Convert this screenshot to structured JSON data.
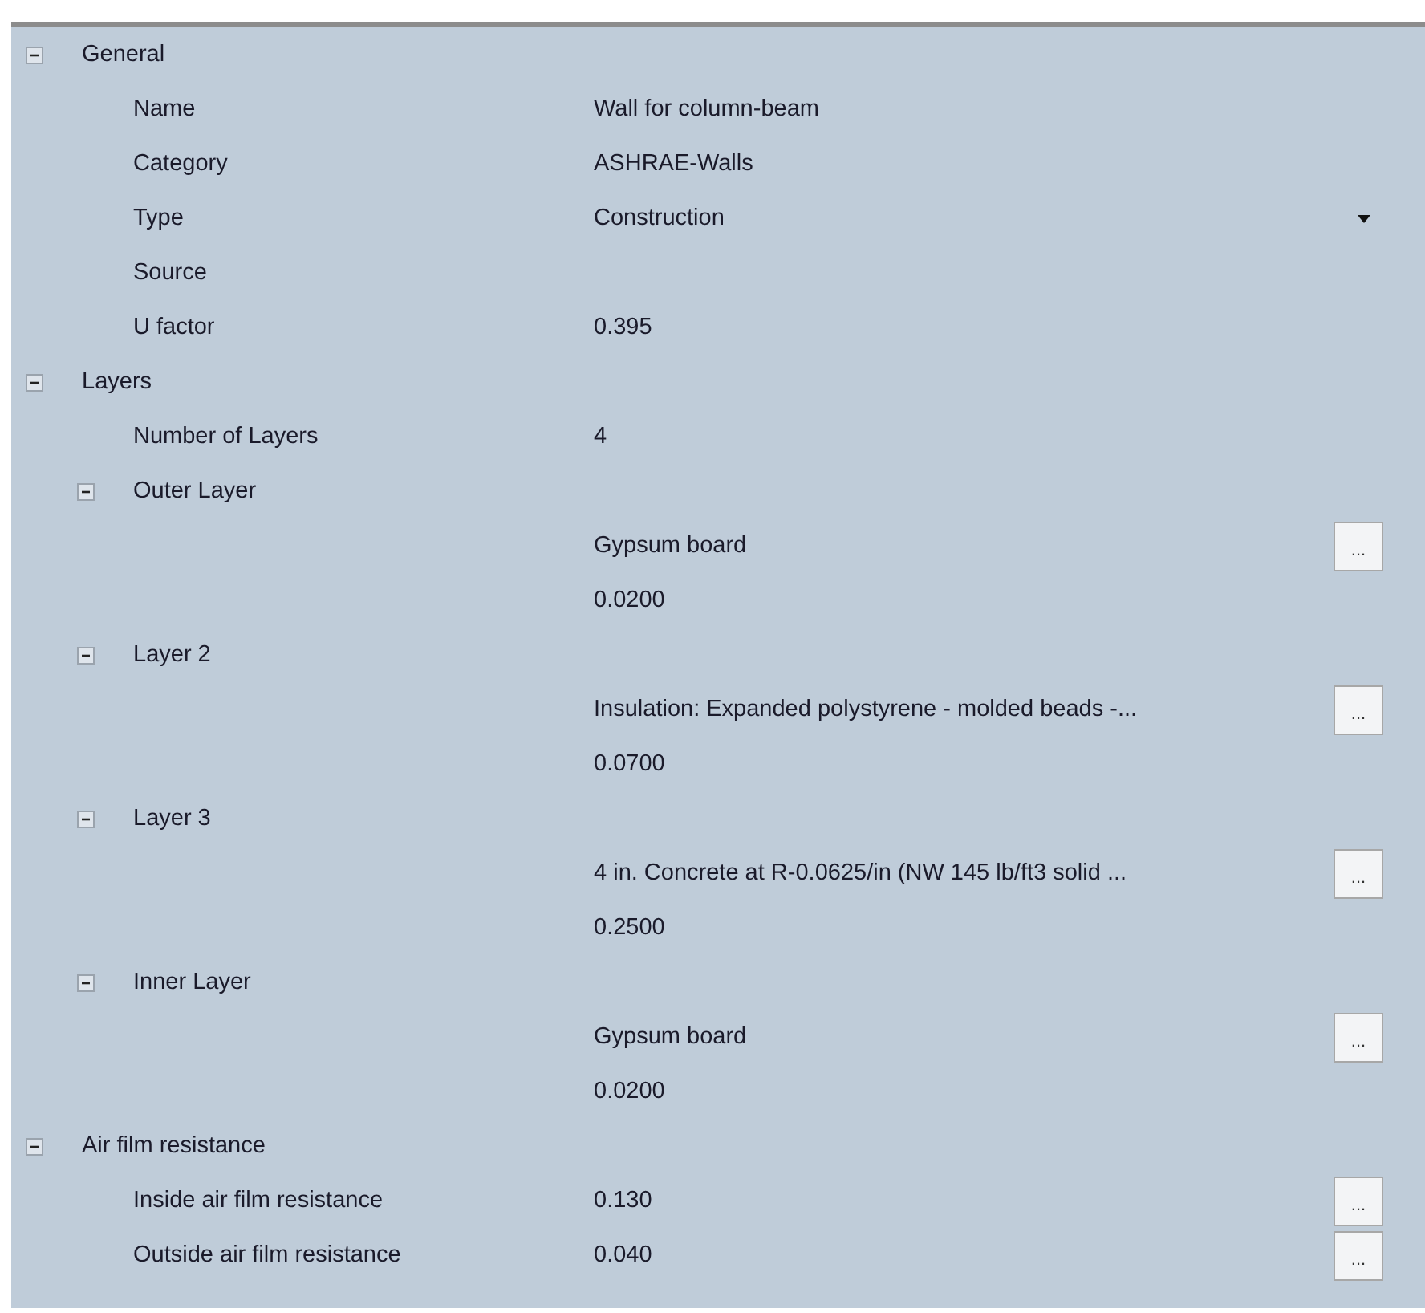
{
  "sections": [
    {
      "label": "General",
      "expanded": true,
      "children": [
        {
          "label": "Name",
          "value": "Wall for column-beam"
        },
        {
          "label": "Category",
          "value": "ASHRAE-Walls"
        },
        {
          "label": "Type",
          "value": "Construction",
          "dropdown": true
        },
        {
          "label": "Source"
        },
        {
          "label": "U factor",
          "value": "0.395"
        }
      ]
    },
    {
      "label": "Layers",
      "expanded": true,
      "children": [
        {
          "label": "Number of Layers",
          "value": "4"
        },
        {
          "label": "Outer Layer",
          "expanded": true,
          "children": [
            {
              "value": "Gypsum board",
              "button": "..."
            },
            {
              "value": "0.0200"
            }
          ]
        },
        {
          "label": "Layer 2",
          "expanded": true,
          "children": [
            {
              "value": "Insulation: Expanded polystyrene - molded beads -...",
              "button": "..."
            },
            {
              "value": "0.0700"
            }
          ]
        },
        {
          "label": "Layer 3",
          "expanded": true,
          "children": [
            {
              "value": "4 in. Concrete at R-0.0625/in (NW 145 lb/ft3 solid ...",
              "button": "..."
            },
            {
              "value": "0.2500"
            }
          ]
        },
        {
          "label": "Inner Layer",
          "expanded": true,
          "children": [
            {
              "value": "Gypsum board",
              "button": "..."
            },
            {
              "value": "0.0200"
            }
          ]
        }
      ]
    },
    {
      "label": "Air film resistance",
      "expanded": true,
      "children": [
        {
          "label": "Inside air film resistance",
          "value": "0.130",
          "button": "..."
        },
        {
          "label": "Outside air film resistance",
          "value": "0.040",
          "button": "..."
        }
      ]
    }
  ]
}
